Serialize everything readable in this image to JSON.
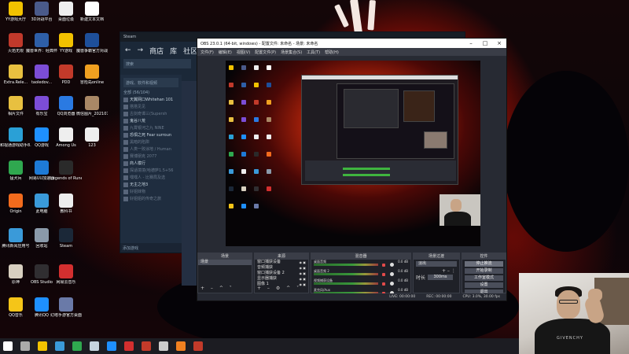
{
  "desktop_icons": [
    {
      "label": "YY游戏大厅",
      "color": "#f2c200"
    },
    {
      "label": "3D对战平台",
      "color": "#4a5a8a"
    },
    {
      "label": "桌面垃圾",
      "color": "#eeeeee"
    },
    {
      "label": "新建文本文档",
      "color": "#ffffff"
    },
    {
      "label": "火焰无限",
      "color": "#c0392b"
    },
    {
      "label": "魔兽世界：经典怀旧服",
      "color": "#2e5fa8"
    },
    {
      "label": "YY游戏",
      "color": "#f2c200"
    },
    {
      "label": "魔兽争霸官方对战平台",
      "color": "#1e4f9a"
    },
    {
      "label": "Extra.Rele...",
      "color": "#e8c040"
    },
    {
      "label": "taoledov...",
      "color": "#7c4dd6"
    },
    {
      "label": "PDD",
      "color": "#c23a2a"
    },
    {
      "label": "冒险岛online",
      "color": "#f0a020"
    },
    {
      "label": "相片文件",
      "color": "#e8c040"
    },
    {
      "label": "有乐宝",
      "color": "#7c4dd6"
    },
    {
      "label": "QQ浏览器",
      "color": "#2a7ae2"
    },
    {
      "label": "微信图片_2021072...",
      "color": "#aa8866"
    },
    {
      "label": "和视通游戏助手8.0",
      "color": "#2aa0d6"
    },
    {
      "label": "QQ游戏",
      "color": "#1e90ff"
    },
    {
      "label": "Among Us",
      "color": "#eeeeee"
    },
    {
      "label": "123",
      "color": "#eeeeee"
    },
    {
      "label": "猛犬兵",
      "color": "#2fa84f"
    },
    {
      "label": "网易UU加速器",
      "color": "#1e7ad6"
    },
    {
      "label": "Legends of Runeterra",
      "color": "#2a2a2a"
    },
    {
      "label": "Origin",
      "color": "#f26b1d"
    },
    {
      "label": "此电脑",
      "color": "#3a9ad9"
    },
    {
      "label": "教科书",
      "color": "#eeeeee"
    },
    {
      "label": "腾讯新闻应用号",
      "color": "#3a9ad9"
    },
    {
      "label": "回收站",
      "color": "#8a9aaa"
    },
    {
      "label": "Steam",
      "color": "#1b2838"
    },
    {
      "label": "原神",
      "color": "#d8d0c0"
    },
    {
      "label": "OBS Studio",
      "color": "#302e31"
    },
    {
      "label": "网易云音乐",
      "color": "#d32f2f"
    },
    {
      "label": "QQ音乐",
      "color": "#f5c518"
    },
    {
      "label": "腾讯QQ",
      "color": "#1e90ff"
    },
    {
      "label": "幻塔手游官方桌面版",
      "color": "#6a7aa8"
    }
  ],
  "steam": {
    "title": "Steam",
    "nav": {
      "store": "商店",
      "library": "库",
      "community": "社区"
    },
    "search_placeholder": "游戏、软件和视频",
    "search2": "搜索",
    "section": "全部 (56/104)",
    "games": [
      {
        "name": "天翼网口Whitehan 101",
        "dim": false
      },
      {
        "name": "搭搭见见",
        "dim": true
      },
      {
        "name": "古剑奇谭三(Supersh",
        "dim": true
      },
      {
        "name": "鬼谷八荒",
        "dim": false
      },
      {
        "name": "九霄银河之九 NINE",
        "dim": true
      },
      {
        "name": "恐惧之死 Fear surroun",
        "dim": false
      },
      {
        "name": "黑暗的陷阱",
        "dim": true
      },
      {
        "name": "人类一败涂地 / Human",
        "dim": true
      },
      {
        "name": "赛博朋克 2077",
        "dim": true
      },
      {
        "name": "商人模行",
        "dim": false
      },
      {
        "name": "探适境境(哈德萨1.5+56",
        "dim": true
      },
      {
        "name": "嘿嘿人 - 比赛局及选",
        "dim": true
      },
      {
        "name": "无主之地3",
        "dim": false
      },
      {
        "name": "好姐妹物",
        "dim": true
      },
      {
        "name": "好姐姐的传奇之旅",
        "dim": true
      }
    ],
    "footer": "添加游戏"
  },
  "obs": {
    "title": "OBS 23.0.1 (64-bit, windows) - 配置文件: 未命名 - 场景: 未命名",
    "menu": [
      "文件(F)",
      "编辑(E)",
      "视图(V)",
      "配置文件(P)",
      "场景集合(S)",
      "工具(T)",
      "帮助(H)"
    ],
    "scenes": {
      "header": "场景",
      "items": [
        "场景"
      ]
    },
    "sources": {
      "header": "来源",
      "items": [
        "窗口捕获设备",
        "音频捕获",
        "窗口捕获设备 2",
        "显示器捕获",
        "图像 1"
      ]
    },
    "mixer": {
      "header": "混音器",
      "channels": [
        {
          "name": "桌面音频",
          "db": "0.0 dB"
        },
        {
          "name": "桌面音频 2",
          "db": "0.0 dB"
        },
        {
          "name": "视频捕获设备",
          "db": "0.0 dB"
        },
        {
          "name": "麦克风/Aux",
          "db": "0.0 dB"
        }
      ]
    },
    "transitions": {
      "header": "场景过渡",
      "type": "淡出",
      "duration_label": "时长",
      "duration": "300ms"
    },
    "controls": {
      "header": "控件",
      "buttons": [
        "停止推流",
        "开始录制",
        "工作室模式",
        "设置",
        "退出"
      ]
    },
    "status": {
      "live": "LIVE: 00:00:00",
      "rec": "REC: 00:00:00",
      "cpu": "CPU: 3.0%, 30.00 fps"
    }
  },
  "webcam": {
    "shirt_text": "GIVENCHY"
  },
  "taskbar": {
    "items": [
      {
        "name": "start",
        "color": "#ffffff"
      },
      {
        "name": "task-view",
        "color": "#aaaaaa"
      },
      {
        "name": "file-explorer",
        "color": "#f2c200"
      },
      {
        "name": "browser",
        "color": "#3a9ad9"
      },
      {
        "name": "edge",
        "color": "#2fa84f"
      },
      {
        "name": "steam",
        "color": "#c6d4df"
      },
      {
        "name": "qq",
        "color": "#1e90ff"
      },
      {
        "name": "netease-music",
        "color": "#d32f2f"
      },
      {
        "name": "red-app",
        "color": "#c23a2a"
      },
      {
        "name": "obs",
        "color": "#cccccc"
      },
      {
        "name": "g-app",
        "color": "#f08020"
      },
      {
        "name": "red-app-2",
        "color": "#c23a2a"
      }
    ]
  }
}
